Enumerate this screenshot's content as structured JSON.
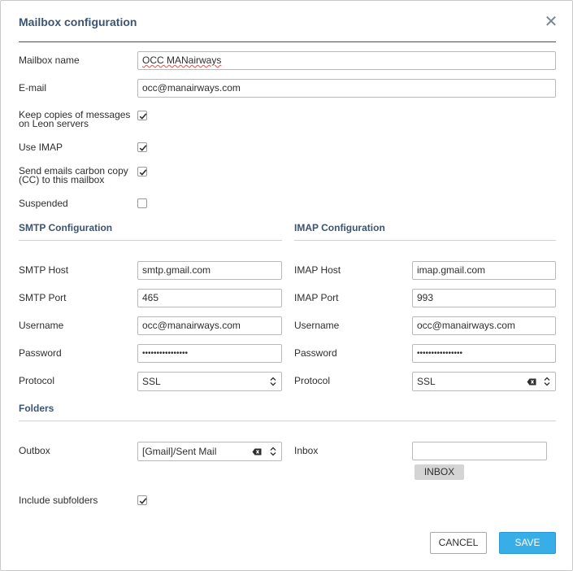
{
  "dialog": {
    "title": "Mailbox configuration",
    "close_icon": "close-icon"
  },
  "general": {
    "mailbox_name_label": "Mailbox name",
    "mailbox_name_value": "OCC MANairways",
    "email_label": "E-mail",
    "email_value": "occ@manairways.com",
    "keep_copies_label_1": "Keep copies of messages",
    "keep_copies_label_2": "on Leon servers",
    "keep_copies_checked": true,
    "use_imap_label": "Use IMAP",
    "use_imap_checked": true,
    "send_cc_label_1": "Send emails carbon copy",
    "send_cc_label_2": "(CC) to this mailbox",
    "send_cc_checked": true,
    "suspended_label": "Suspended",
    "suspended_checked": false
  },
  "smtp": {
    "section_title": "SMTP Configuration",
    "host_label": "SMTP Host",
    "host_value": "smtp.gmail.com",
    "port_label": "SMTP Port",
    "port_value": "465",
    "username_label": "Username",
    "username_value": "occ@manairways.com",
    "password_label": "Password",
    "password_value": "••••••••••••••••",
    "protocol_label": "Protocol",
    "protocol_value": "SSL"
  },
  "imap": {
    "section_title": "IMAP Configuration",
    "host_label": "IMAP Host",
    "host_value": "imap.gmail.com",
    "port_label": "IMAP Port",
    "port_value": "993",
    "username_label": "Username",
    "username_value": "occ@manairways.com",
    "password_label": "Password",
    "password_value": "••••••••••••••••",
    "protocol_label": "Protocol",
    "protocol_value": "SSL"
  },
  "folders": {
    "section_title": "Folders",
    "outbox_label": "Outbox",
    "outbox_value": "[Gmail]/Sent Mail",
    "inbox_label": "Inbox",
    "inbox_value": "",
    "inbox_button": "INBOX",
    "include_subfolders_label": "Include subfolders",
    "include_subfolders_checked": true
  },
  "actions": {
    "cancel": "CANCEL",
    "save": "SAVE"
  },
  "colors": {
    "accent": "#37aee8",
    "heading": "#3b5470",
    "rule": "#cfd3d8"
  }
}
